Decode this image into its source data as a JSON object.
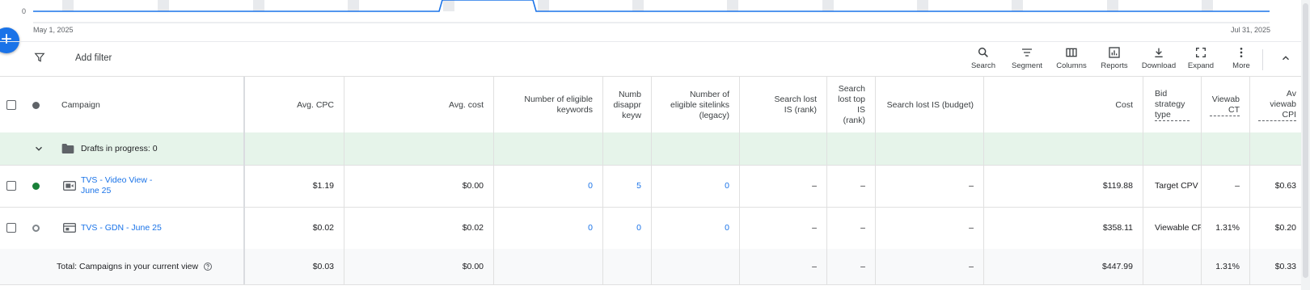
{
  "chart": {
    "y_tick_label": "0",
    "start_date": "May 1, 2025",
    "end_date": "Jul 31, 2025",
    "line_color": "#1a73e8"
  },
  "toolbar": {
    "add_filter": "Add filter",
    "buttons": [
      {
        "label": "Search",
        "icon": "search-icon"
      },
      {
        "label": "Segment",
        "icon": "segment-icon"
      },
      {
        "label": "Columns",
        "icon": "columns-icon"
      },
      {
        "label": "Reports",
        "icon": "reports-icon"
      },
      {
        "label": "Download",
        "icon": "download-icon"
      },
      {
        "label": "Expand",
        "icon": "expand-icon"
      },
      {
        "label": "More",
        "icon": "more-vert-icon"
      }
    ]
  },
  "table": {
    "headers": {
      "campaign": "Campaign",
      "avg_cpc": "Avg. CPC",
      "avg_cost": "Avg. cost",
      "eligible_keywords": "Number of eligible keywords",
      "disapproved_keywords": "Numb disappr keyw",
      "eligible_sitelinks": "Number of eligible sitelinks (legacy)",
      "lost_is_rank": "Search lost IS (rank)",
      "lost_top_is_rank": "Search lost top IS (rank)",
      "lost_is_budget": "Search lost IS (budget)",
      "cost": "Cost",
      "bid_strategy": "Bid strategy type",
      "viewable_ctr": "Viewab CT",
      "avg_vcpm": "Av viewab CPI"
    },
    "drafts": {
      "label": "Drafts in progress: 0"
    },
    "rows": [
      {
        "name": "TVS  - Video View - June 25",
        "status_color": "#188038",
        "type_icon": "video-campaign-icon",
        "avg_cpc": "$1.19",
        "avg_cost": "$0.00",
        "eligible_keywords": "0",
        "disapproved_keywords": "5",
        "eligible_sitelinks": "0",
        "lost_is_rank": "–",
        "lost_top_is_rank": "–",
        "lost_is_budget": "–",
        "cost": "$119.88",
        "bid_strategy": "Target CPV",
        "viewable_ctr": "–",
        "avg_vcpm": "$0.63"
      },
      {
        "name": "TVS - GDN - June 25",
        "status_color": "#80868b",
        "type_icon": "display-campaign-icon",
        "avg_cpc": "$0.02",
        "avg_cost": "$0.02",
        "eligible_keywords": "0",
        "disapproved_keywords": "0",
        "eligible_sitelinks": "0",
        "lost_is_rank": "–",
        "lost_top_is_rank": "–",
        "lost_is_budget": "–",
        "cost": "$358.11",
        "bid_strategy": "Viewable CP",
        "viewable_ctr": "1.31%",
        "avg_vcpm": "$0.20"
      }
    ],
    "total": {
      "label": "Total: Campaigns in your current view",
      "avg_cpc": "$0.03",
      "avg_cost": "$0.00",
      "lost_is_rank": "–",
      "lost_top_is_rank": "–",
      "lost_is_budget": "–",
      "cost": "$447.99",
      "viewable_ctr": "1.31%",
      "avg_vcpm": "$0.33"
    }
  }
}
